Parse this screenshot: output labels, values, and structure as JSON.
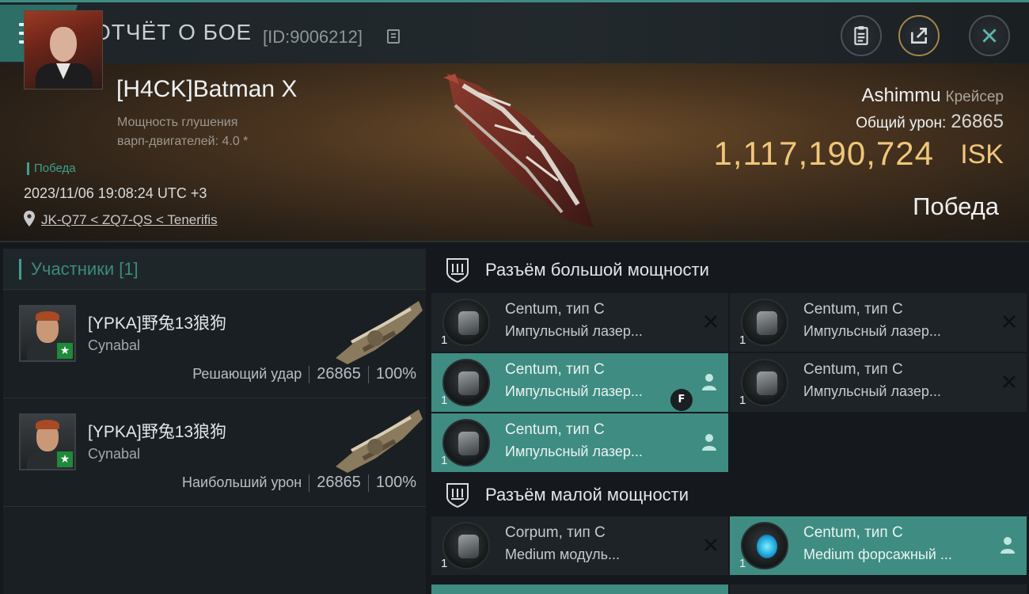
{
  "header": {
    "title": "ОТЧЁТ О БОЕ",
    "report_id": "[ID:9006212]",
    "icons": [
      "menu-icon",
      "copy-icon",
      "clipboard-icon",
      "share-icon",
      "close-icon"
    ]
  },
  "victim": {
    "pilot_name": "[H4CK]Batman X",
    "warp_line1": "Мощность глушения",
    "warp_line2": "варп-двигателей: 4.0 *",
    "result_tag": "Победа",
    "timestamp": "2023/11/06 19:08:24 UTC +3",
    "location": "JK-Q77 < ZQ7-QS < Tenerifis",
    "ship_name": "Ashimmu",
    "ship_class": "Крейсер",
    "total_damage_label": "Общий урон:",
    "total_damage": "26865",
    "isk_value": "1,117,190,724",
    "isk_unit": "ISK",
    "outcome": "Победа"
  },
  "participants": {
    "header": "Участники [1]",
    "rows": [
      {
        "name": "[YPKA]野兔13狼狗",
        "ship": "Cynabal",
        "label": "Решающий удар",
        "damage": "26865",
        "percent": "100%"
      },
      {
        "name": "[YPKA]野兔13狼狗",
        "ship": "Cynabal",
        "label": "Наибольший урон",
        "damage": "26865",
        "percent": "100%"
      }
    ]
  },
  "fitting": {
    "high_slot_title": "Разъём большой мощности",
    "low_slot_title": "Разъём малой мощности",
    "modules": [
      {
        "name": "Centum, тип C",
        "type": "Импульсный лазер...",
        "qty": "1",
        "state": "destroyed"
      },
      {
        "name": "Centum, тип C",
        "type": "Импульсный лазер...",
        "qty": "1",
        "state": "destroyed"
      },
      {
        "name": "Centum, тип C",
        "type": "Импульсный лазер...",
        "qty": "1",
        "state": "dropped",
        "badge": "F"
      },
      {
        "name": "Centum, тип C",
        "type": "Импульсный лазер...",
        "qty": "1",
        "state": "destroyed"
      },
      {
        "name": "Centum, тип C",
        "type": "Импульсный лазер...",
        "qty": "1",
        "state": "dropped"
      },
      {
        "name": "Corpum, тип C",
        "type": "Medium модуль...",
        "qty": "1",
        "state": "destroyed"
      },
      {
        "name": "Centum, тип C",
        "type": "Medium форсажный ...",
        "qty": "1",
        "state": "dropped"
      }
    ]
  },
  "colors": {
    "accent": "#3f8c82",
    "isk": "#f0c67a",
    "active_module": "#3f8c82"
  }
}
